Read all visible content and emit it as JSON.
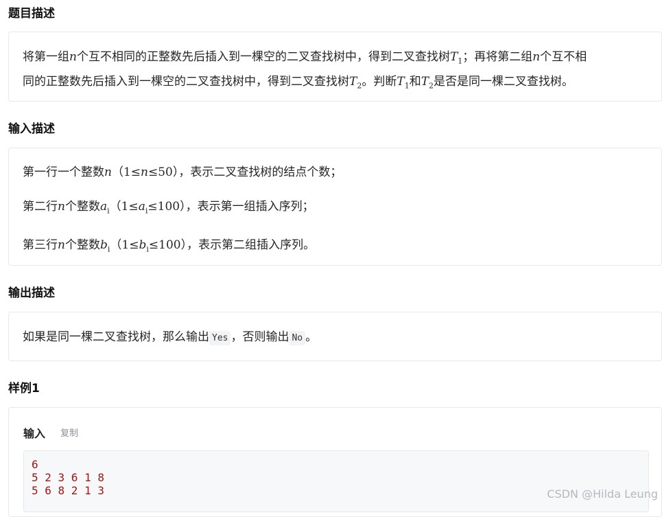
{
  "problem": {
    "title": "题目描述",
    "line1_a": "将第一组",
    "var_n": "n",
    "line1_b": "个互不相同的正整数先后插入到一棵空的二叉查找树中，得到二叉查找树",
    "var_T": "T",
    "sub_1": "1",
    "sub_2": "2",
    "line1_c": "；再将第二组",
    "line1_d": "个互不相",
    "line2_a": "同的正整数先后插入到一棵空的二叉查找树中，得到二叉查找树",
    "line2_b": "。判断",
    "line2_c": "和",
    "line2_d": "是否是同一棵二叉查找树。"
  },
  "input": {
    "title": "输入描述",
    "l1_a": "第一行一个整数",
    "var_n": "n",
    "l1_paren_open": "（",
    "one": "1",
    "le": "≤",
    "l1_max": "50",
    "paren_close": "）",
    "l1_b": "，表示二叉查找树的结点个数；",
    "l2_a": "第二行",
    "l2_b": "个整数",
    "var_a": "a",
    "sub_i": "i",
    "l2_max": "100",
    "l2_c": "，表示第一组插入序列；",
    "l3_a": "第三行",
    "var_b": "b",
    "l3_c": "，表示第二组插入序列。"
  },
  "output": {
    "title": "输出描述",
    "a": "如果是同一棵二叉查找树，那么输出",
    "yes": "Yes",
    "b": "，否则输出",
    "no": "No",
    "c": "。"
  },
  "sample": {
    "title": "样例1",
    "input_label": "输入",
    "copy_label": "复制",
    "code": "6\n5 2 3 6 1 8\n5 6 8 2 1 3"
  },
  "watermark": "CSDN @Hilda Leung"
}
